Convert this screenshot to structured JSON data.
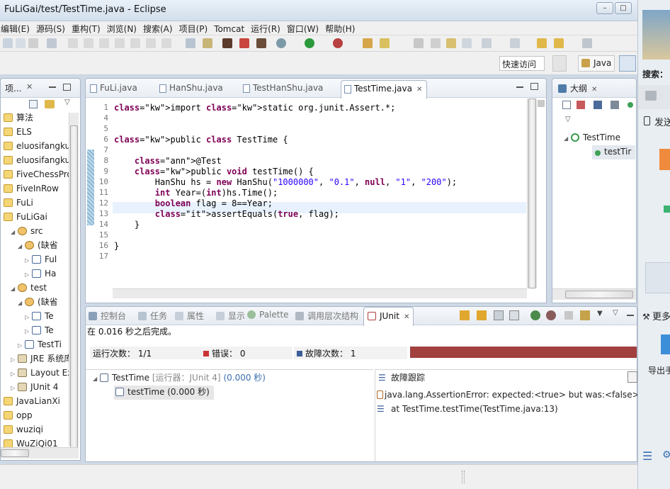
{
  "window": {
    "title": "FuLiGai/test/TestTime.java - Eclipse"
  },
  "menu": [
    "编辑(E)",
    "源码(S)",
    "重构(T)",
    "浏览(N)",
    "搜索(A)",
    "项目(P)",
    "Tomcat",
    "运行(R)",
    "窗口(W)",
    "帮助(H)"
  ],
  "quick_access": "快速访问",
  "perspective": {
    "java_label": "Java"
  },
  "explorer": {
    "title": "项...",
    "items": [
      {
        "label": "算法",
        "indent": 0,
        "icon": "project"
      },
      {
        "label": "ELS",
        "indent": 0,
        "icon": "project"
      },
      {
        "label": "eluosifangku",
        "indent": 0,
        "icon": "project"
      },
      {
        "label": "eluosifangku",
        "indent": 0,
        "icon": "project"
      },
      {
        "label": "FiveChessPro",
        "indent": 0,
        "icon": "project"
      },
      {
        "label": "FiveInRow",
        "indent": 0,
        "icon": "project"
      },
      {
        "label": "FuLi",
        "indent": 0,
        "icon": "project"
      },
      {
        "label": "FuLiGai",
        "indent": 0,
        "icon": "project"
      },
      {
        "label": "src",
        "indent": 1,
        "icon": "package"
      },
      {
        "label": "(缺省",
        "indent": 2,
        "icon": "package"
      },
      {
        "label": "Ful",
        "indent": 3,
        "icon": "java"
      },
      {
        "label": "Ha",
        "indent": 3,
        "icon": "java"
      },
      {
        "label": "test",
        "indent": 1,
        "icon": "package"
      },
      {
        "label": "(缺省",
        "indent": 2,
        "icon": "package"
      },
      {
        "label": "Te",
        "indent": 3,
        "icon": "java"
      },
      {
        "label": "Te",
        "indent": 3,
        "icon": "java"
      },
      {
        "label": "TestTi",
        "indent": 2,
        "icon": "java"
      },
      {
        "label": "JRE 系统库",
        "indent": 1,
        "icon": "jre"
      },
      {
        "label": "Layout Ex",
        "indent": 1,
        "icon": "jre"
      },
      {
        "label": "JUnit 4",
        "indent": 1,
        "icon": "jre"
      },
      {
        "label": "JavaLianXi",
        "indent": 0,
        "icon": "project"
      },
      {
        "label": "opp",
        "indent": 0,
        "icon": "project"
      },
      {
        "label": "wuziqi",
        "indent": 0,
        "icon": "project"
      },
      {
        "label": "WuZiQi01",
        "indent": 0,
        "icon": "project"
      }
    ]
  },
  "editor": {
    "tabs": [
      {
        "label": "FuLi.java",
        "active": false
      },
      {
        "label": "HanShu.java",
        "active": false
      },
      {
        "label": "TestHanShu.java",
        "active": false
      },
      {
        "label": "TestTime.java",
        "active": true
      }
    ],
    "lines": [
      {
        "n": "1",
        "text": "import static org.junit.Assert.*;"
      },
      {
        "n": "4",
        "text": ""
      },
      {
        "n": "5",
        "text": ""
      },
      {
        "n": "6",
        "text": "public class TestTime {"
      },
      {
        "n": "7",
        "text": ""
      },
      {
        "n": "8",
        "text": "    @Test"
      },
      {
        "n": "9",
        "text": "    public void testTime() {"
      },
      {
        "n": "10",
        "text": "        HanShu hs = new HanShu(\"1000000\", \"0.1\", null, \"1\", \"200\");"
      },
      {
        "n": "11",
        "text": "        int Year=(int)hs.Time();"
      },
      {
        "n": "12",
        "text": "        boolean flag = 8==Year;"
      },
      {
        "n": "13",
        "text": "        assertEquals(true, flag);"
      },
      {
        "n": "14",
        "text": "    }"
      },
      {
        "n": "15",
        "text": ""
      },
      {
        "n": "16",
        "text": "}"
      },
      {
        "n": "17",
        "text": ""
      }
    ]
  },
  "outline": {
    "tab": "大纲",
    "class_name": "TestTime",
    "method": "testTir"
  },
  "bottom": {
    "tabs": [
      "控制台",
      "任务",
      "属性",
      "显示",
      "Palette",
      "调用层次结构",
      "JUnit"
    ],
    "status": "在 0.016 秒之后完成。",
    "runs_label": "运行次数：",
    "runs_value": "1/1",
    "errors_label": "错误：",
    "errors_value": "0",
    "failures_label": "故障次数：",
    "failures_value": "1",
    "tree_root": "TestTime",
    "tree_root_runner": "[运行器：JUnit 4]",
    "tree_root_time": "(0.000 秒)",
    "tree_child": "testTime (0.000 秒)",
    "trace_title": "故障跟踪",
    "trace_line1": "java.lang.AssertionError: expected:<true> but was:<false>",
    "trace_line2": "at TestTime.testTime(TestTime.java:13)"
  },
  "right_panel": {
    "search_label": "搜索：",
    "send_label": "发送",
    "more_label": "更多",
    "export_label": "导出手"
  },
  "colors": {
    "failure_bar": "#a23f3f",
    "keyword": "#7f0055",
    "string": "#2a00ff",
    "annotation": "#646464"
  }
}
